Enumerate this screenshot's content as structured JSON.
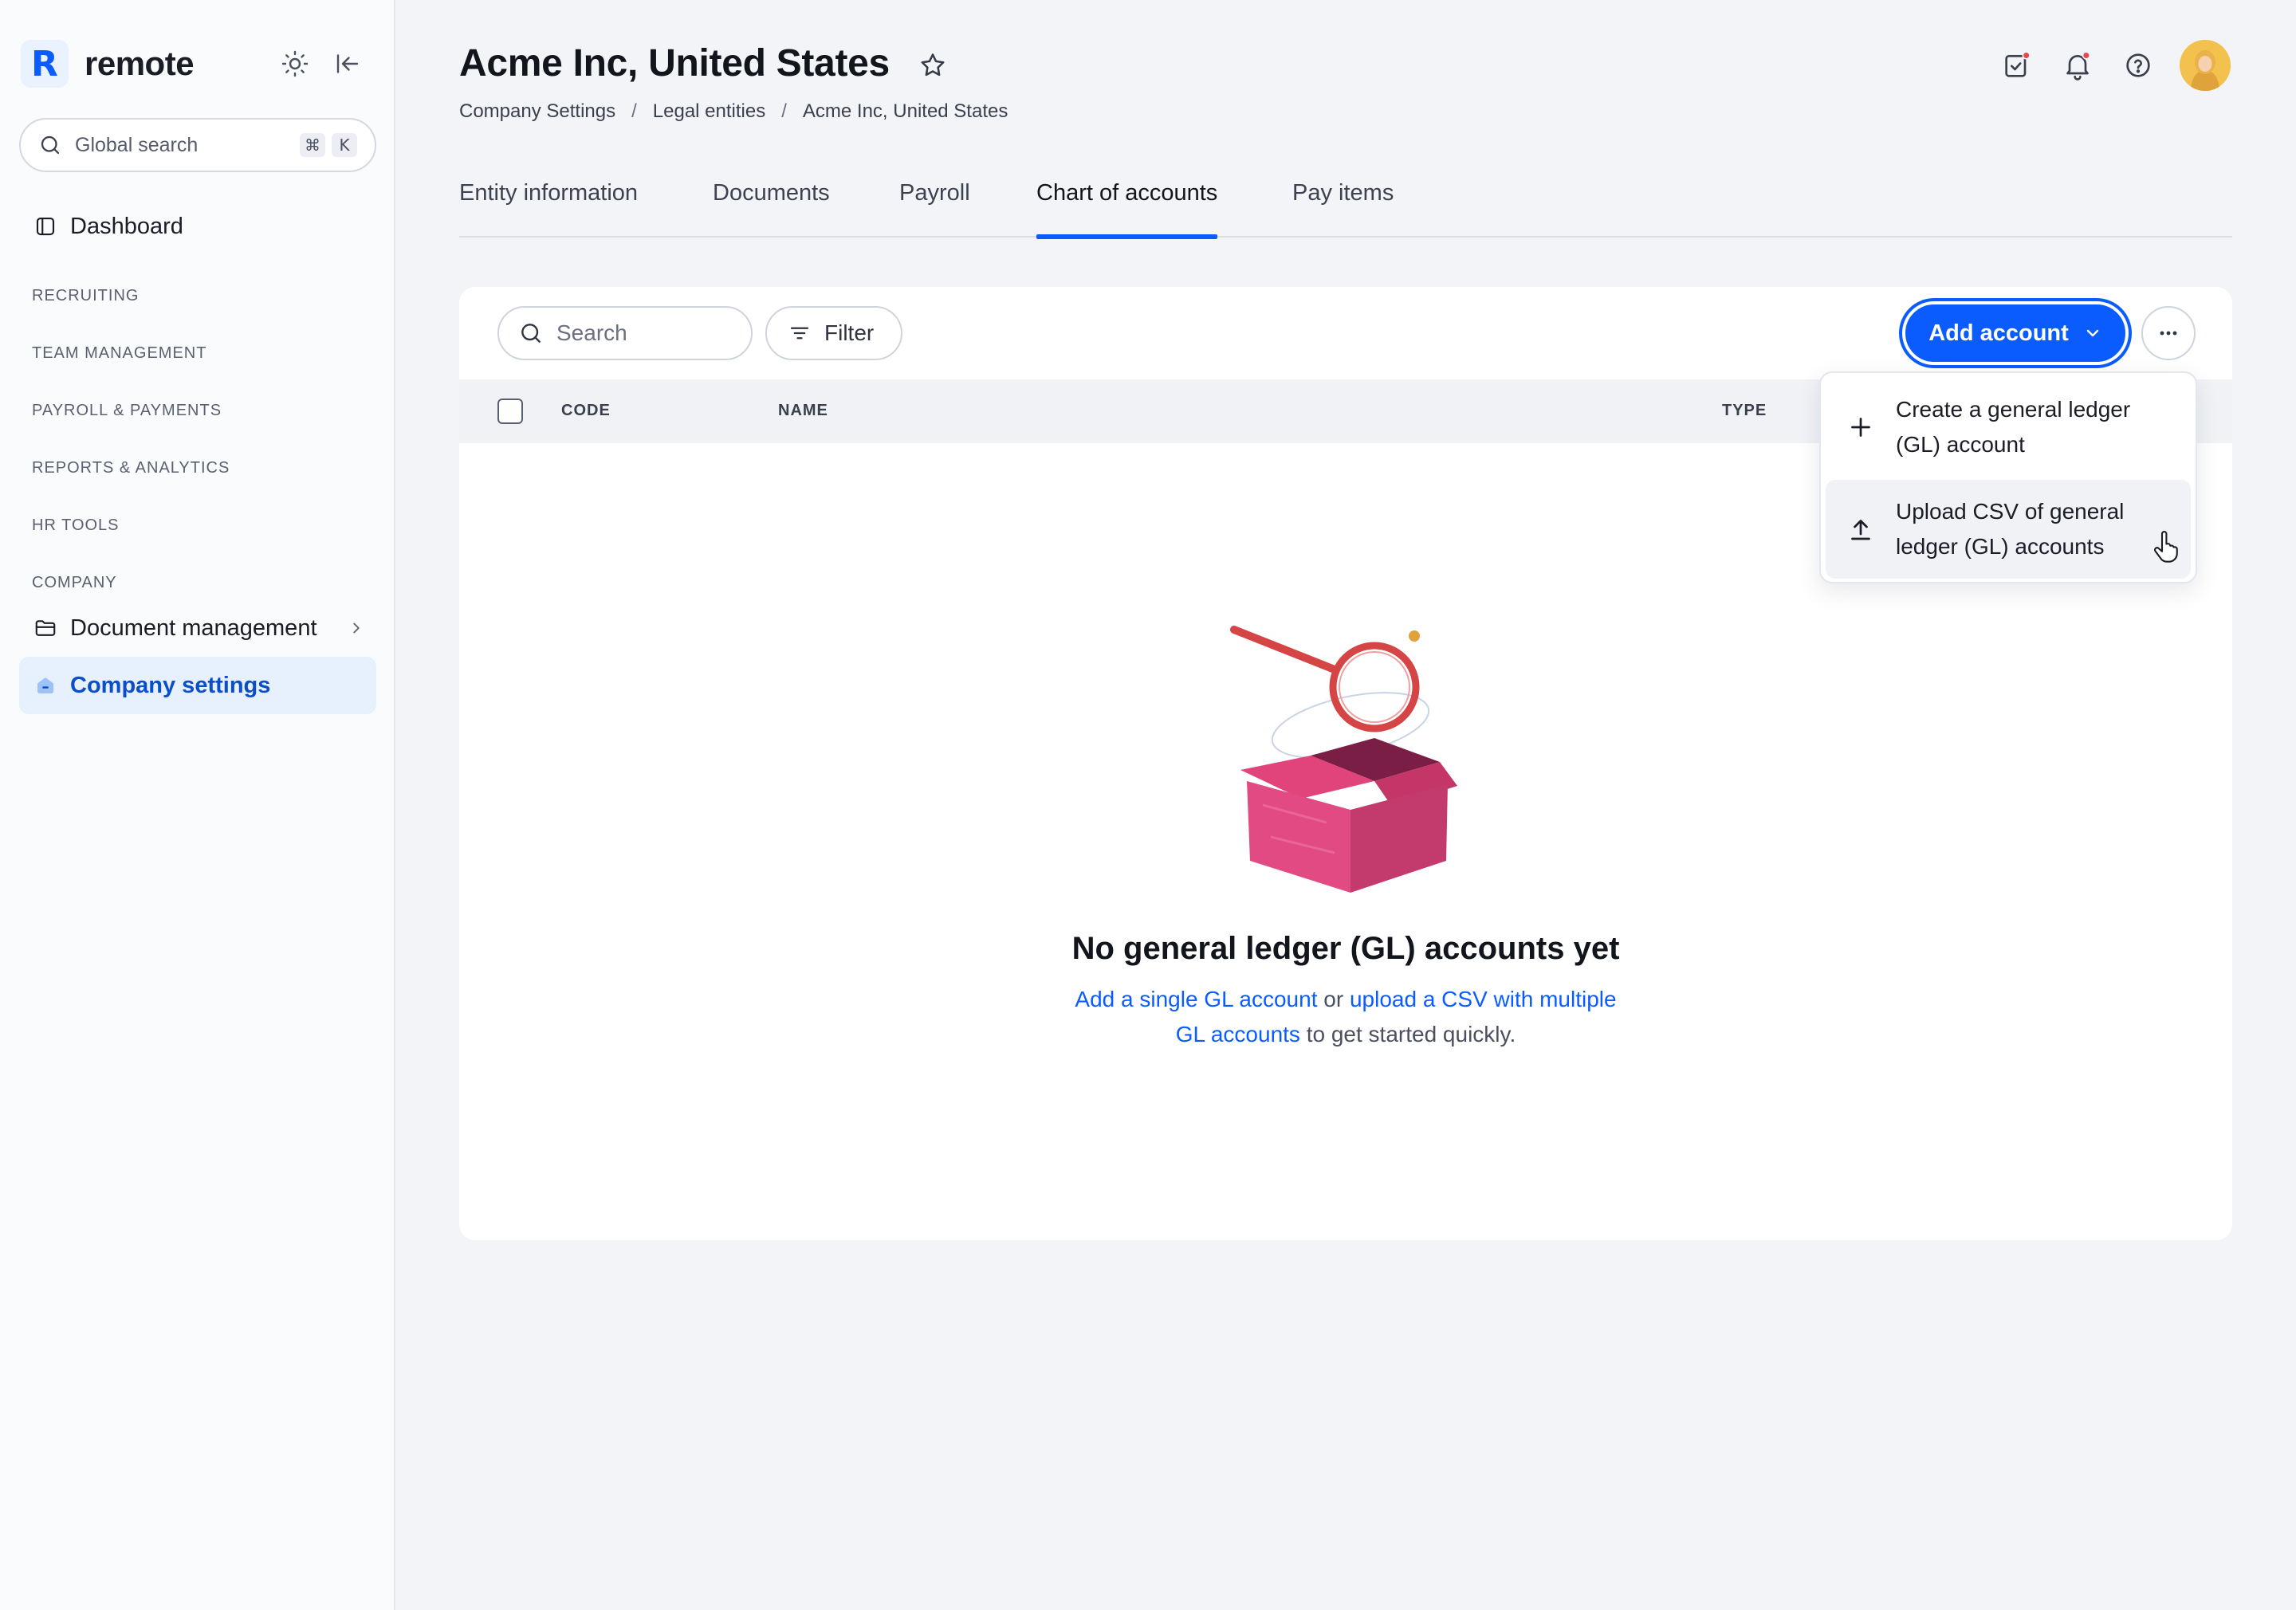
{
  "app": {
    "brand_name": "remote",
    "brand_letter": "R",
    "brand_color": "#0b5cff"
  },
  "sidebar": {
    "search": {
      "placeholder": "Global search",
      "shortcut_keys": [
        "⌘",
        "K"
      ]
    },
    "dashboard_label": "Dashboard",
    "sections": [
      "RECRUITING",
      "TEAM MANAGEMENT",
      "PAYROLL & PAYMENTS",
      "REPORTS & ANALYTICS",
      "HR TOOLS",
      "COMPANY"
    ],
    "items": [
      {
        "label": "Document management",
        "icon": "folder-icon"
      },
      {
        "label": "Company settings",
        "icon": "company-icon",
        "active": true
      }
    ]
  },
  "header": {
    "title": "Acme Inc, United States",
    "breadcrumb": [
      "Company Settings",
      "Legal entities",
      "Acme Inc, United States"
    ]
  },
  "tabs": [
    {
      "label": "Entity information"
    },
    {
      "label": "Documents"
    },
    {
      "label": "Payroll"
    },
    {
      "label": "Chart of accounts",
      "active": true
    },
    {
      "label": "Pay items"
    }
  ],
  "toolbar": {
    "search_placeholder": "Search",
    "filter_label": "Filter",
    "add_account_label": "Add account"
  },
  "table": {
    "columns": [
      "CODE",
      "NAME",
      "TYPE"
    ]
  },
  "dropdown": {
    "items": [
      {
        "label": "Create a general ledger (GL) account",
        "icon": "plus-icon"
      },
      {
        "label": "Upload CSV of general ledger (GL) accounts",
        "icon": "upload-icon",
        "hovered": true
      }
    ]
  },
  "empty_state": {
    "title": "No general ledger (GL) accounts yet",
    "link_single": "Add a single GL account",
    "or_text": " or ",
    "link_csv": "upload a CSV with multiple GL accounts",
    "suffix": " to get started quickly."
  }
}
